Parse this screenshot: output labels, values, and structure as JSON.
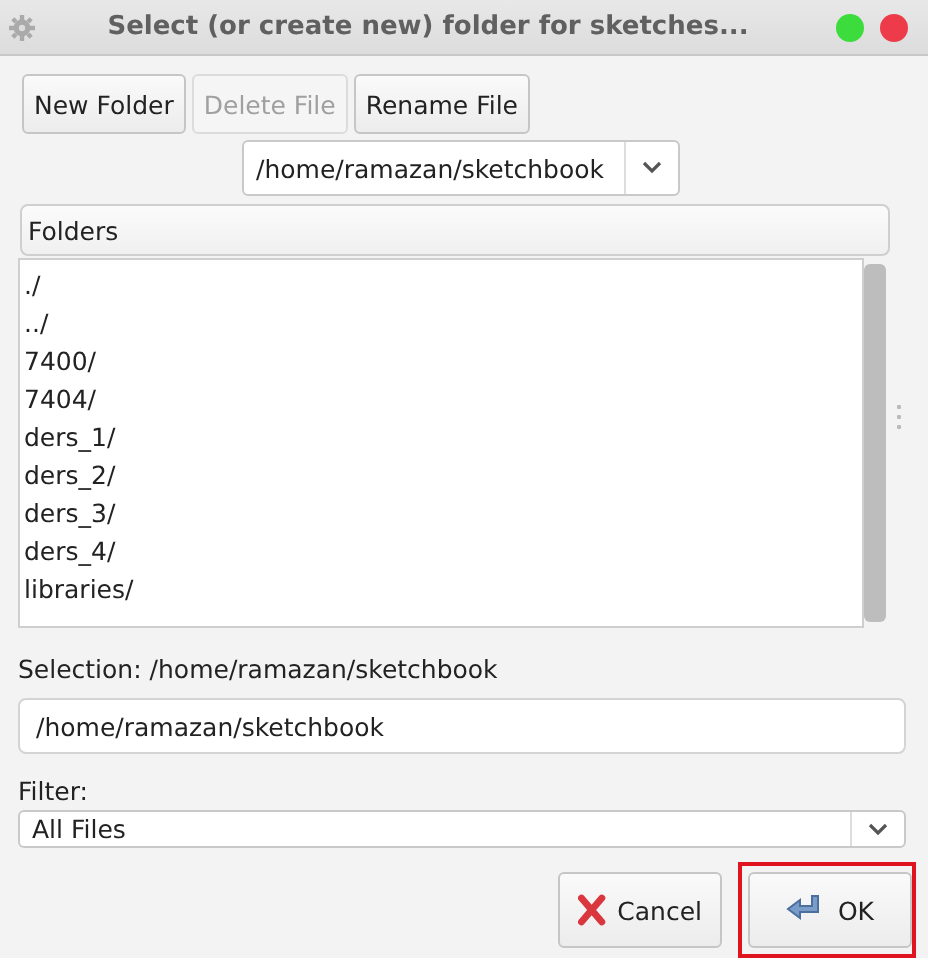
{
  "window": {
    "title": "Select (or create new) folder for sketches..."
  },
  "toolbar": [
    {
      "label": "New Folder",
      "disabled": false
    },
    {
      "label": "Delete File",
      "disabled": true
    },
    {
      "label": "Rename File",
      "disabled": false
    }
  ],
  "path_combo": {
    "value": "/home/ramazan/sketchbook"
  },
  "folders": {
    "header": "Folders",
    "items": [
      "./",
      "../",
      "7400/",
      "7404/",
      "ders_1/",
      "ders_2/",
      "ders_3/",
      "ders_4/",
      "libraries/"
    ]
  },
  "selection": {
    "label": "Selection: /home/ramazan/sketchbook",
    "value": "/home/ramazan/sketchbook"
  },
  "filter": {
    "label": "Filter:",
    "value": "All Files"
  },
  "buttons": [
    {
      "label": "Cancel",
      "kind": "cancel",
      "highlighted": false
    },
    {
      "label": "OK",
      "kind": "ok",
      "highlighted": true
    }
  ]
}
